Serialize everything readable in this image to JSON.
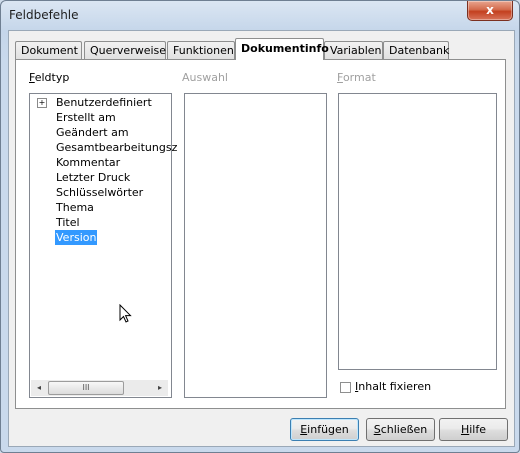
{
  "window": {
    "title": "Feldbefehle",
    "close_glyph": "x"
  },
  "tabs": [
    {
      "label": "Dokument",
      "active": false
    },
    {
      "label": "Querverweise",
      "active": false
    },
    {
      "label": "Funktionen",
      "active": false
    },
    {
      "label": "Dokumentinfo",
      "active": true
    },
    {
      "label": "Variablen",
      "active": false
    },
    {
      "label": "Datenbank",
      "active": false
    }
  ],
  "feldtyp": {
    "label": "Feldtyp",
    "items": [
      {
        "label": "Benutzerdefiniert",
        "expandable": true,
        "expander": "+"
      },
      {
        "label": "Erstellt am"
      },
      {
        "label": "Geändert am"
      },
      {
        "label": "Gesamtbearbeitungsz"
      },
      {
        "label": "Kommentar"
      },
      {
        "label": "Letzter Druck"
      },
      {
        "label": "Schlüsselwörter"
      },
      {
        "label": "Thema"
      },
      {
        "label": "Titel"
      },
      {
        "label": "Version",
        "selected": true
      }
    ],
    "scrollbar": {
      "left": "◂",
      "right": "▸",
      "thumb": "III"
    }
  },
  "auswahl": {
    "label": "Auswahl",
    "enabled": false
  },
  "format": {
    "label": "Format",
    "enabled": false
  },
  "inhalt_fixieren": {
    "label": "Inhalt fixieren",
    "checked": false
  },
  "buttons": {
    "insert": "Einfügen",
    "close": "Schließen",
    "help": "Hilfe"
  },
  "colors": {
    "selection": "#3399ff",
    "window_frame": "#c5d6ea",
    "close_button": "#c3401f"
  }
}
